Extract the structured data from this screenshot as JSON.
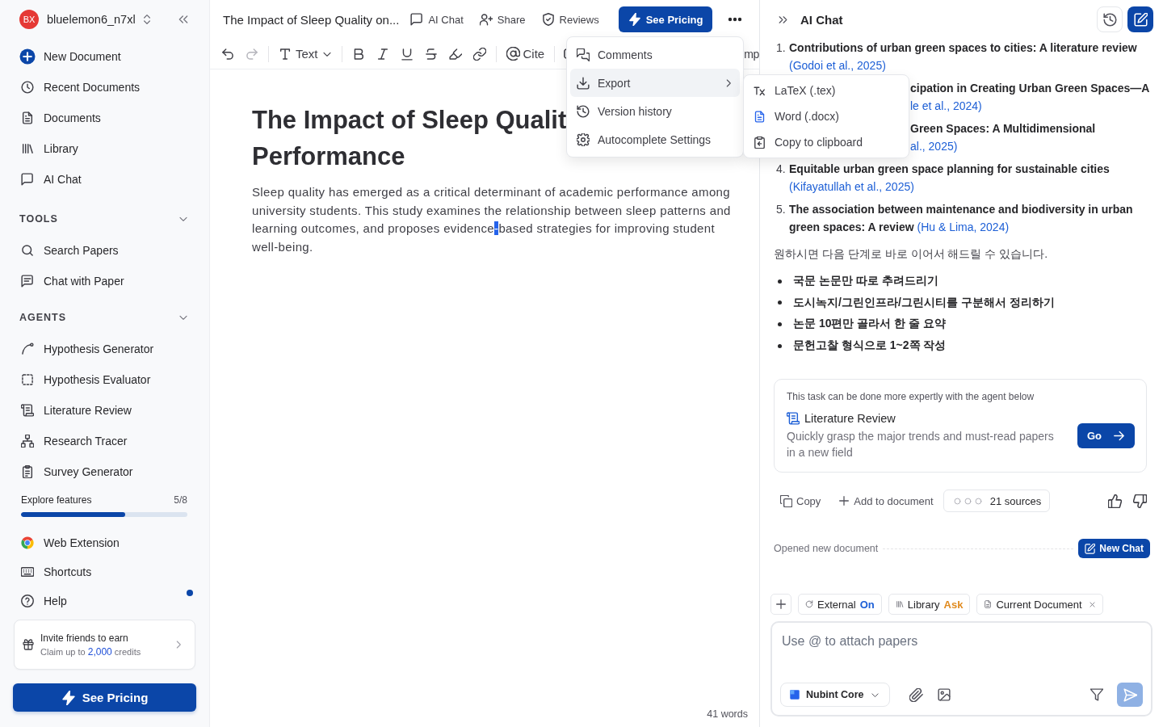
{
  "sidebar": {
    "user": {
      "initials": "BX",
      "name": "bluelemon6_n7xl"
    },
    "nav": [
      {
        "label": "New Document"
      },
      {
        "label": "Recent Documents"
      },
      {
        "label": "Documents"
      },
      {
        "label": "Library"
      },
      {
        "label": "AI Chat"
      }
    ],
    "sections": [
      {
        "title": "TOOLS",
        "expanded": true,
        "items": [
          {
            "label": "Search Papers"
          },
          {
            "label": "Chat with Paper"
          }
        ]
      },
      {
        "title": "AGENTS",
        "expanded": true,
        "items": [
          {
            "label": "Hypothesis Generator"
          },
          {
            "label": "Hypothesis Evaluator"
          },
          {
            "label": "Literature Review"
          },
          {
            "label": "Research Tracer"
          },
          {
            "label": "Survey Generator"
          }
        ]
      }
    ],
    "progress": {
      "label": "Explore features",
      "count": "5/8",
      "level": 0.625
    },
    "links": [
      {
        "label": "Web Extension",
        "unread": false
      },
      {
        "label": "Shortcuts",
        "unread": false
      },
      {
        "label": "Help",
        "unread": true
      }
    ],
    "invite": {
      "title": "Invite friends to earn",
      "subtitle": "Claim up to **2,000** credits"
    },
    "pricing_button": "See Pricing"
  },
  "editor": {
    "doc_title": "The Impact of Sleep Quality on...",
    "actions": [
      {
        "label": "AI Chat"
      },
      {
        "label": "Share"
      },
      {
        "label": "Reviews"
      }
    ],
    "pricing_button": "See Pricing",
    "toolbar": {
      "undo_disabled": false,
      "redo_disabled": true,
      "text_style": "Text",
      "cite": "Cite",
      "clipped_label": "mp"
    },
    "heading_lines": [
      "The Impact of Sleep Qualit",
      "Performance"
    ],
    "paragraph": {
      "before": "Sleep quality has emerged as a critical determinant of academic performance among university students. This study examines the relationship between sleep patterns and learning outcomes, and proposes evidence",
      "selected": "-",
      "after": "based strategies for improving student well-being."
    },
    "word_count": "41 words",
    "more_menu": [
      {
        "label": "Comments",
        "selected": false,
        "has_submenu": false
      },
      {
        "label": "Export",
        "selected": true,
        "has_submenu": true
      },
      {
        "label": "Version history",
        "selected": false,
        "has_submenu": false
      },
      {
        "label": "Autocomplete Settings",
        "selected": false,
        "has_submenu": false
      }
    ],
    "export_menu": [
      {
        "label": "LaTeX (.tex)"
      },
      {
        "label": "Word (.docx)"
      },
      {
        "label": "Copy to clipboard"
      }
    ]
  },
  "chat": {
    "title": "AI Chat",
    "references": [
      {
        "kind": "full",
        "number": "1.",
        "title": "Contributions of urban green spaces to cities: A literature review",
        "citation": "(Godoi et al., 2025)"
      },
      {
        "kind": "partial",
        "title": "cipation in Creating Urban Green Spaces—A",
        "citation": "le et al., 2024)"
      },
      {
        "kind": "partial",
        "title": "Green Spaces: A Multidimensional",
        "citation": "al., 2025)"
      },
      {
        "kind": "full",
        "number": "4.",
        "title": "Equitable urban green space planning for sustainable cities",
        "citation": "(Kifayatullah et al., 2025)"
      },
      {
        "kind": "full",
        "number": "5.",
        "title": "The association between maintenance and biodiversity in urban green spaces: A review",
        "citation": "(Hu & Lima, 2024)"
      }
    ],
    "followup": "원하시면 다음 단계로 바로 이어서 해드릴 수 있습니다.",
    "suggestions": [
      "국문 논문만 따로 추려드리기",
      "도시녹지/그린인프라/그린시티를 구분해서 정리하기",
      "논문 10편만 골라서 한 줄 요약",
      "문헌고찰 형식으로 1~2쪽 작성"
    ],
    "agent_card": {
      "note": "This task can be done more expertly with the agent below",
      "name": "Literature Review",
      "description": "Quickly grasp the major trends and must-read papers in a new field",
      "button": "Go"
    },
    "actions": {
      "copy": "Copy",
      "add": "Add to document",
      "sources": "21 sources"
    },
    "event": {
      "text": "Opened new document",
      "button": "New Chat"
    },
    "chips": [
      {
        "kind": "toggle",
        "label": "External",
        "status": "On",
        "color": "#1d5fd6"
      },
      {
        "kind": "toggle",
        "label": "Library",
        "status": "Ask",
        "color": "#e08a1e"
      },
      {
        "kind": "context",
        "label": "Current Document"
      }
    ],
    "composer": {
      "placeholder": "Use @ to attach papers",
      "model": "Nubint Core",
      "send_disabled": true
    }
  }
}
